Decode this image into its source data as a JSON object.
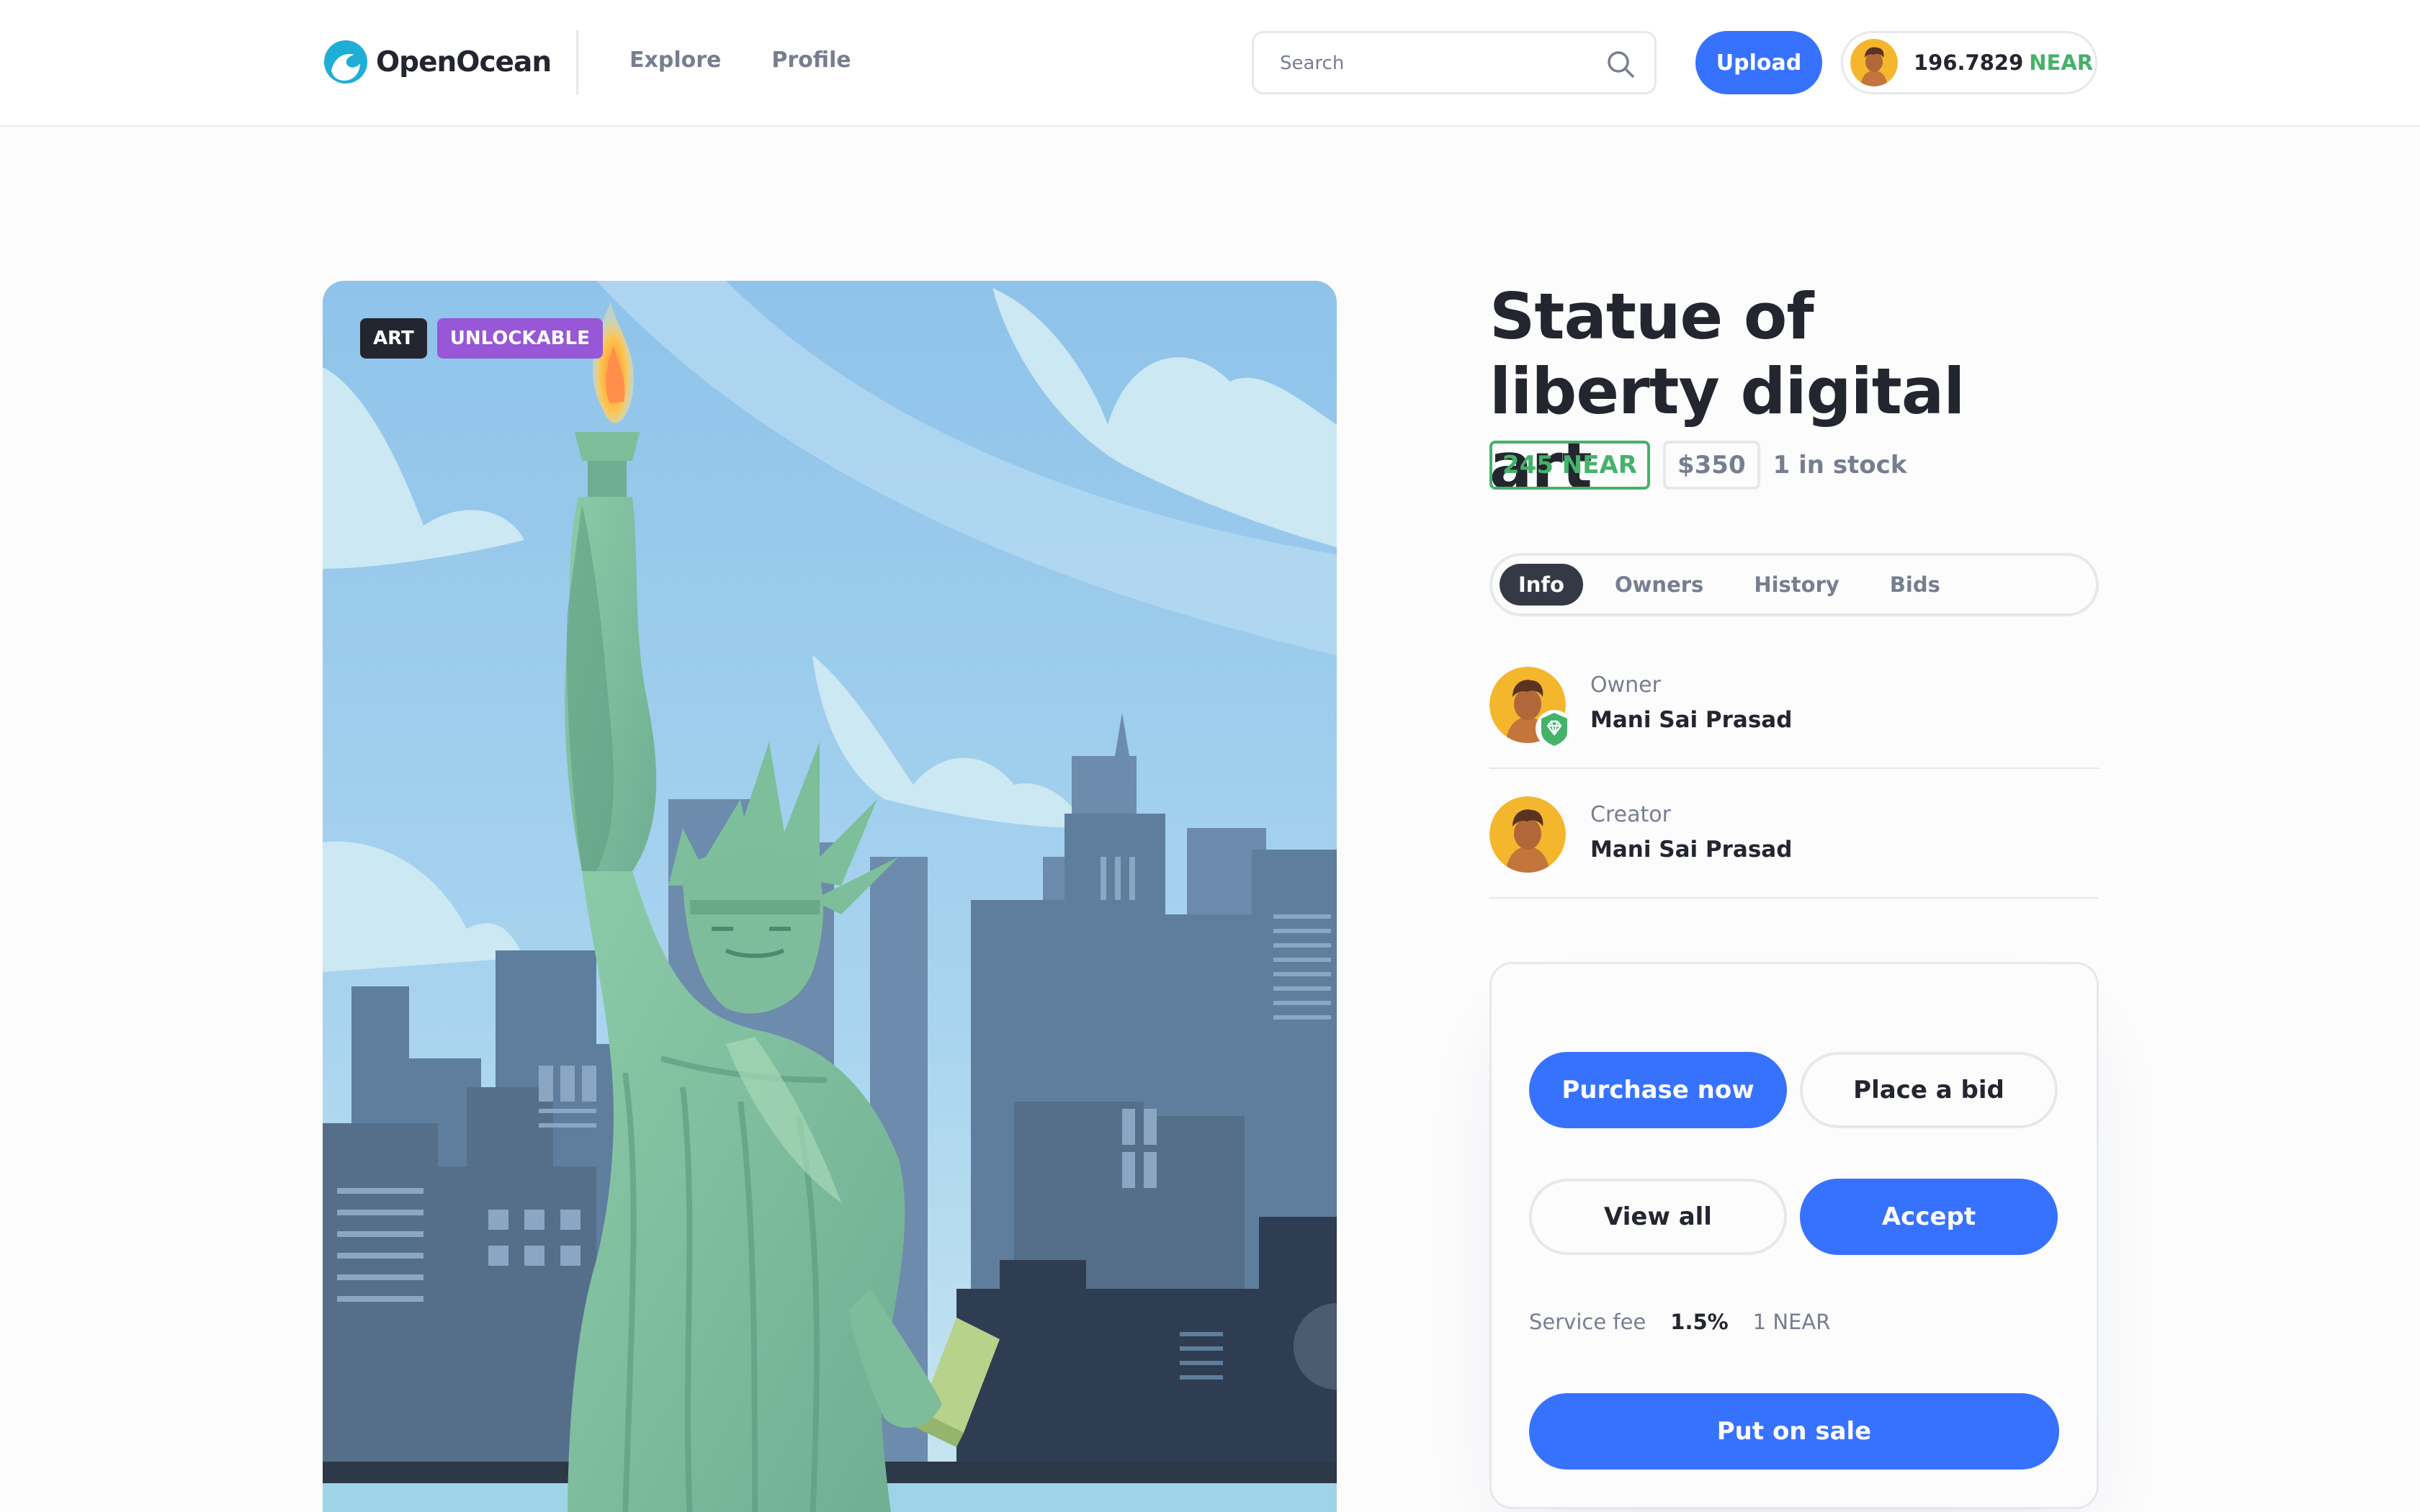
{
  "header": {
    "logo_text": "OpenOcean",
    "nav": [
      "Explore",
      "Profile"
    ],
    "search_placeholder": "Search",
    "upload_label": "Upload",
    "wallet_amount": "196.7829",
    "wallet_currency": "NEAR"
  },
  "item": {
    "tags": [
      "ART",
      "UNLOCKABLE"
    ],
    "title": "Statue of liberty digital art",
    "price_near": "245 NEAR",
    "price_usd": "$350",
    "stock": "1 in stock"
  },
  "tabs": [
    {
      "label": "Info",
      "active": true
    },
    {
      "label": "Owners",
      "active": false
    },
    {
      "label": "History",
      "active": false
    },
    {
      "label": "Bids",
      "active": false
    }
  ],
  "people": {
    "owner": {
      "role": "Owner",
      "name": "Mani Sai Prasad"
    },
    "creator": {
      "role": "Creator",
      "name": "Mani Sai Prasad"
    }
  },
  "actions": {
    "purchase_label": "Purchase now",
    "bid_label": "Place a bid",
    "view_all_label": "View all",
    "accept_label": "Accept",
    "fee_label": "Service fee",
    "fee_percent": "1.5%",
    "fee_amount": "1 NEAR",
    "sale_label": "Put on sale"
  },
  "colors": {
    "primary": "#3772ff",
    "success": "#45b26b",
    "purple": "#9757d7",
    "dark": "#23262f",
    "muted": "#777e90",
    "border": "#e6e8ec"
  },
  "icons": [
    "openocean-logo-icon",
    "search-icon",
    "verified-badge-icon"
  ]
}
